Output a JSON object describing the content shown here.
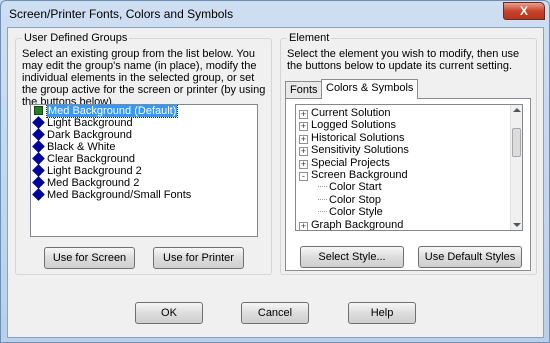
{
  "window": {
    "title": "Screen/Printer Fonts, Colors and Symbols",
    "close_label": "X"
  },
  "left_group": {
    "label": "User Defined Groups",
    "description": "Select an existing group from the list below.  You may edit the group's name (in place), modify the individual elements in the selected group, or set the group active for the screen or printer (by using the buttons below).",
    "items": [
      "Med Background (Default)",
      "Light Background",
      "Dark Background",
      "Black & White",
      "Clear Background",
      "Light Background 2",
      "Med Background 2",
      "Med Background/Small Fonts"
    ],
    "selected_index": 0,
    "use_screen_label": "Use for Screen",
    "use_printer_label": "Use for Printer"
  },
  "right_group": {
    "label": "Element",
    "description": "Select the element you wish to modify, then use the buttons below to update its current setting.",
    "tabs": [
      "Fonts",
      "Colors & Symbols"
    ],
    "active_tab": 1,
    "tree": [
      {
        "label": "Current Solution",
        "expander": "+",
        "level": 0
      },
      {
        "label": "Logged Solutions",
        "expander": "+",
        "level": 0
      },
      {
        "label": "Historical Solutions",
        "expander": "+",
        "level": 0
      },
      {
        "label": "Sensitivity Solutions",
        "expander": "+",
        "level": 0
      },
      {
        "label": "Special Projects",
        "expander": "+",
        "level": 0
      },
      {
        "label": "Screen Background",
        "expander": "-",
        "level": 0
      },
      {
        "label": "Color Start",
        "expander": "",
        "level": 1
      },
      {
        "label": "Color Stop",
        "expander": "",
        "level": 1
      },
      {
        "label": "Color Style",
        "expander": "",
        "level": 1
      },
      {
        "label": "Graph Background",
        "expander": "+",
        "level": 0
      }
    ],
    "select_style_label": "Select Style...",
    "default_styles_label": "Use Default Styles"
  },
  "footer": {
    "ok_label": "OK",
    "cancel_label": "Cancel",
    "help_label": "Help"
  }
}
